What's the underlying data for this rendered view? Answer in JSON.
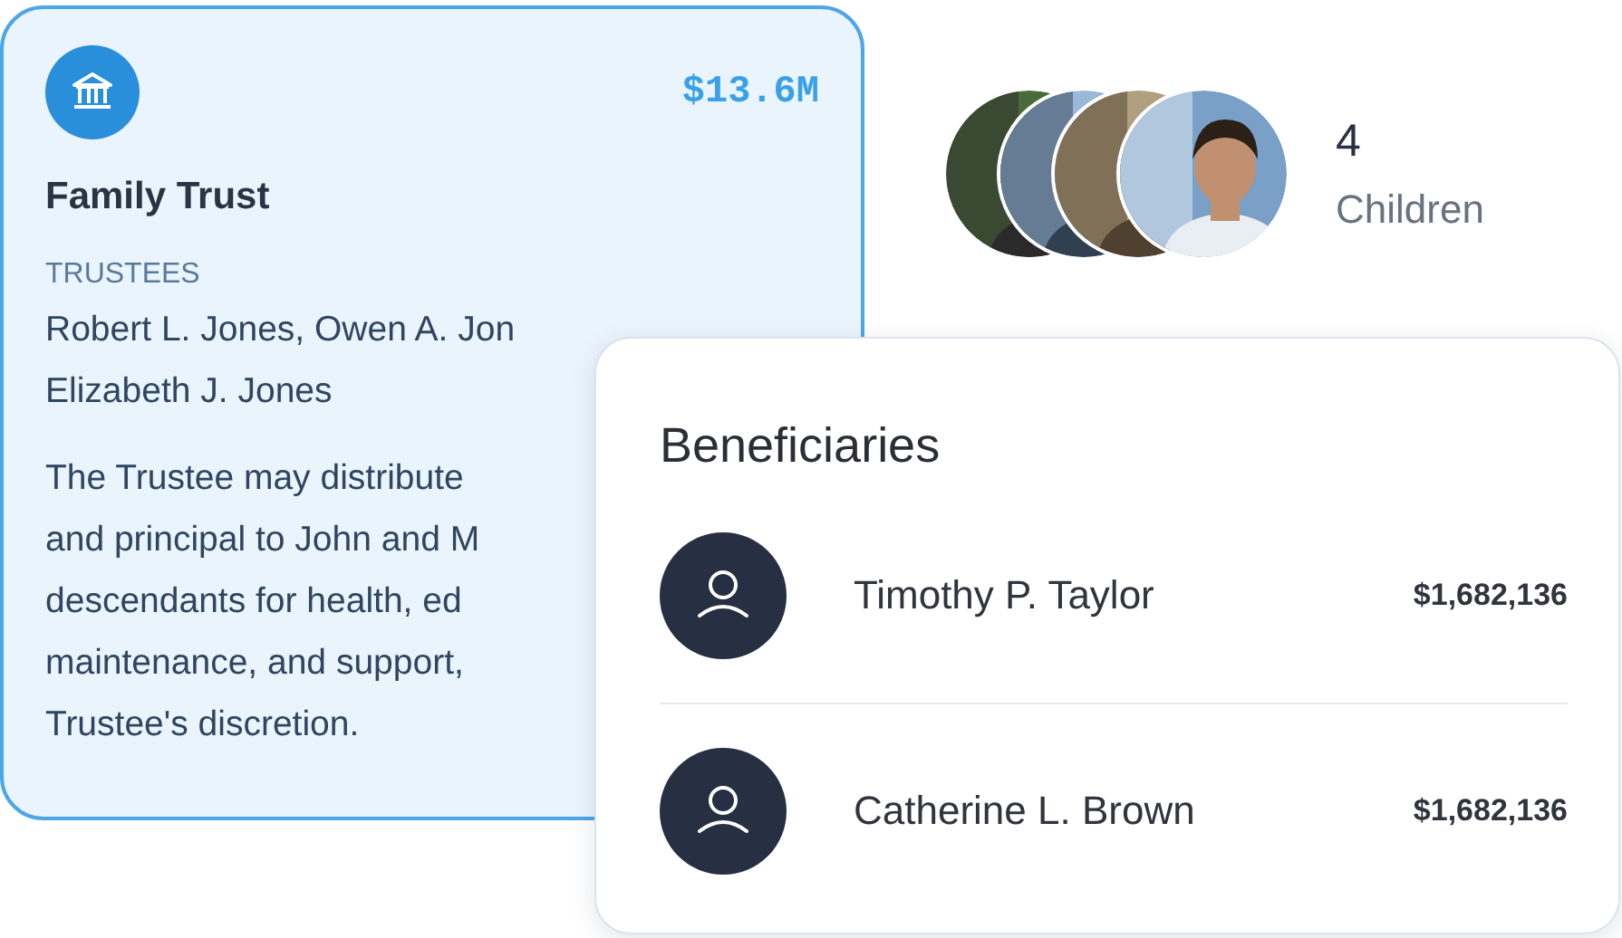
{
  "trust": {
    "amount": "$13.6M",
    "title": "Family Trust",
    "trustees_label": "TRUSTEES",
    "trustees_lines": [
      "Robert L. Jones, Owen A. Jon",
      "Elizabeth J. Jones"
    ],
    "description_lines": [
      "The Trustee may distribute",
      "and principal to John and M",
      "descendants for health, ed",
      "maintenance, and support,",
      "Trustee's discretion."
    ]
  },
  "children": {
    "count": "4",
    "label": "Children"
  },
  "beneficiaries": {
    "title": "Beneficiaries",
    "rows": [
      {
        "name": "Timothy P. Taylor",
        "amount": "$1,682,136"
      },
      {
        "name": "Catherine L. Brown",
        "amount": "$1,682,136"
      }
    ]
  }
}
